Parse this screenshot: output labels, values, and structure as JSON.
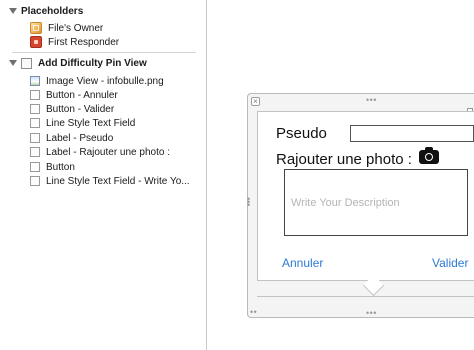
{
  "outline": {
    "placeholders_header": "Placeholders",
    "files_owner": "File's Owner",
    "first_responder": "First Responder",
    "view_header": "Add Difficulty Pin View",
    "items": [
      {
        "label": "Image View - infobulle.png",
        "icon": "image-view-icon"
      },
      {
        "label": "Button - Annuler",
        "icon": "button-icon"
      },
      {
        "label": "Button - Valider",
        "icon": "button-icon"
      },
      {
        "label": "Line Style Text Field",
        "icon": "text-field-icon"
      },
      {
        "label": "Label - Pseudo",
        "icon": "label-icon"
      },
      {
        "label": "Label - Rajouter une photo :",
        "icon": "label-icon"
      },
      {
        "label": "Button",
        "icon": "button-icon"
      },
      {
        "label": "Line Style Text Field - Write Yo...",
        "icon": "text-field-icon"
      }
    ]
  },
  "popover": {
    "pseudo_label": "Pseudo",
    "photo_label": "Rajouter une photo :",
    "description_placeholder": "Write Your Description",
    "cancel_label": "Annuler",
    "validate_label": "Valider"
  },
  "colors": {
    "link_blue": "#2d7ad6",
    "placeholder_gray": "#b4b4b4"
  }
}
